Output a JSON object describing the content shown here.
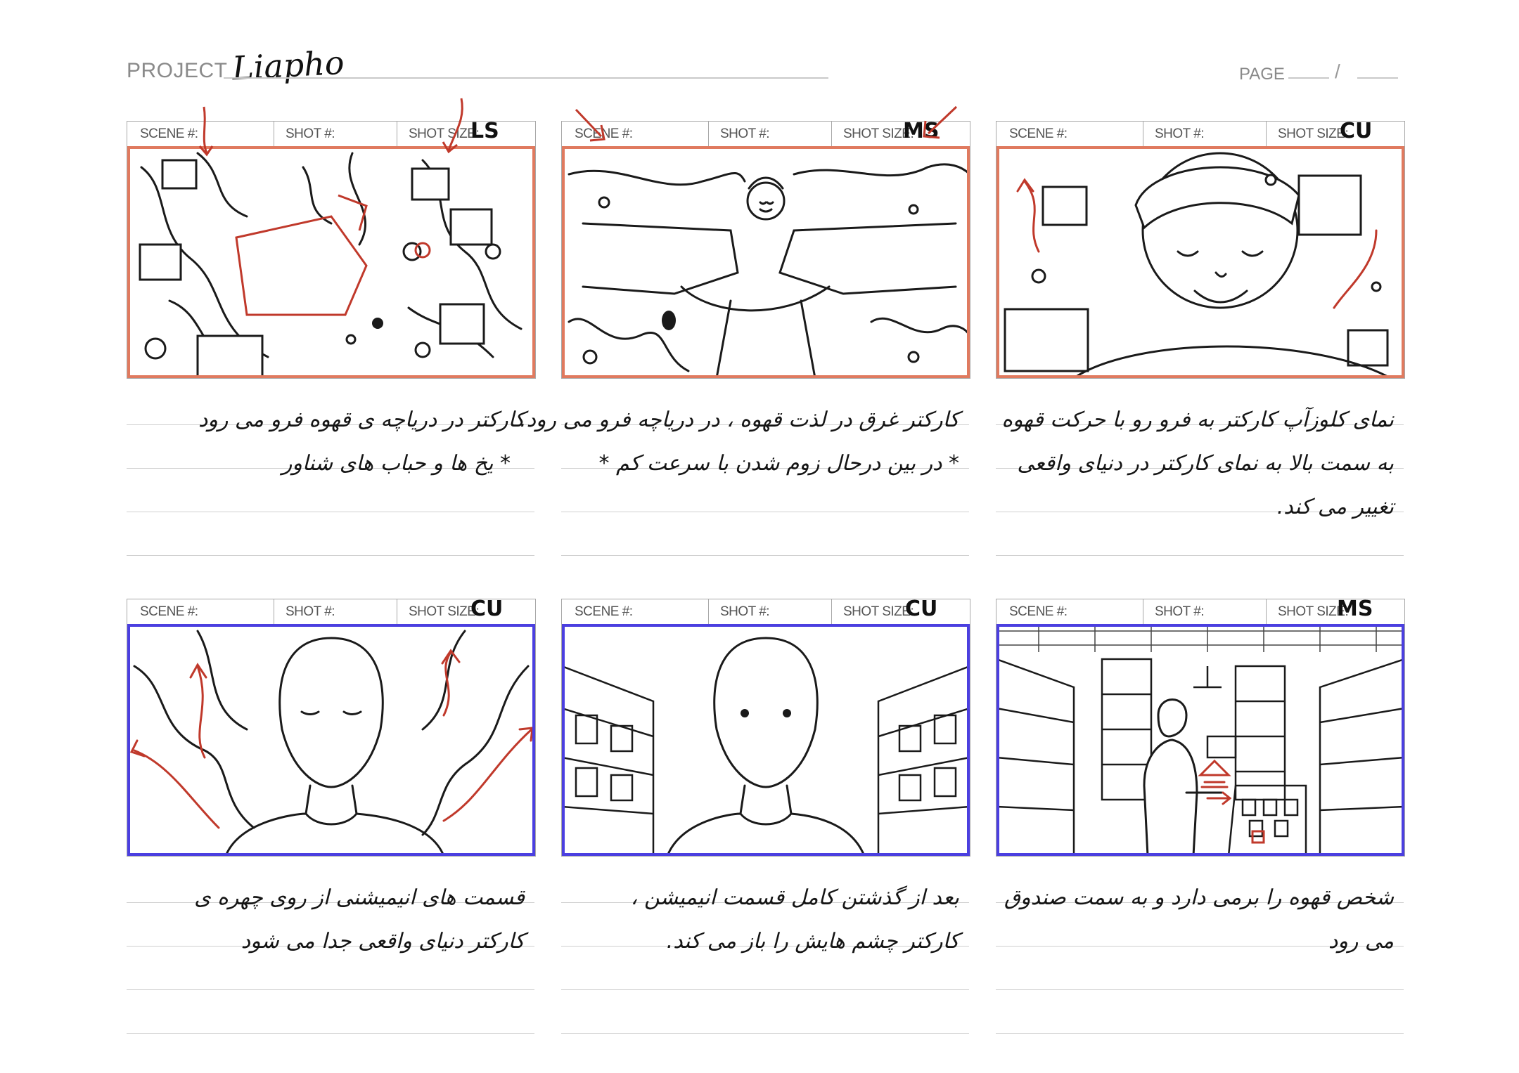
{
  "header": {
    "project_label": "PROJECT",
    "project_name": "Liapho",
    "page_label": "PAGE",
    "page_separator": "/"
  },
  "labels": {
    "scene": "SCENE #:",
    "shot": "SHOT #:",
    "shot_size": "SHOT SIZE:"
  },
  "colors": {
    "highlight_orange": "#e07a5f",
    "highlight_blue": "#4b3fe0",
    "arrow_red": "#c0392b"
  },
  "panels": [
    {
      "shot_size": "LS",
      "highlight": "orange",
      "lines": [
        "کارکتر در دریاچه ی قهوه فرو می رود",
        "* یخ ها و حباب های شناور"
      ]
    },
    {
      "shot_size": "MS",
      "highlight": "orange",
      "lines": [
        "کارکتر غرق در لذت قهوه ، در دریاچه فرو می رود.",
        "* در بین درحال زوم شدن با سرعت کم *"
      ]
    },
    {
      "shot_size": "CU",
      "highlight": "orange",
      "lines": [
        "نمای کلوزآپ کارکتر به فرو رو با حرکت قهوه",
        "به سمت بالا به نمای کارکتر در دنیای واقعی",
        "تغییر می کند."
      ]
    },
    {
      "shot_size": "CU",
      "highlight": "blue",
      "lines": [
        "قسمت های انیمیشنی از روی چهره ی",
        "کارکتر دنیای واقعی جدا می شود"
      ]
    },
    {
      "shot_size": "CU",
      "highlight": "blue",
      "lines": [
        "بعد از گذشتن کامل قسمت انیمیشن ،",
        "کارکتر چشم هایش را باز می کند."
      ]
    },
    {
      "shot_size": "MS",
      "highlight": "blue",
      "lines": [
        "شخص قهوه را برمی دارد و به سمت صندوق",
        "می رود"
      ]
    }
  ]
}
